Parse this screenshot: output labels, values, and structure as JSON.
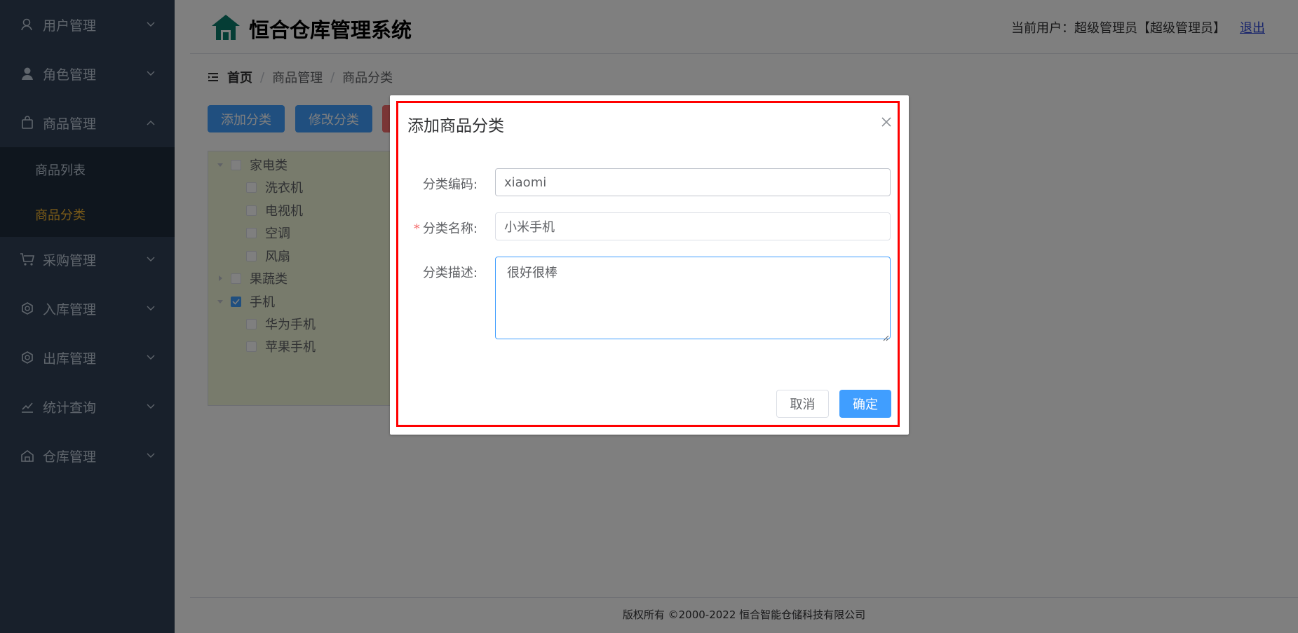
{
  "sidebar": {
    "items": [
      {
        "label": "用户管理",
        "icon": "user-outline-icon",
        "expanded": false
      },
      {
        "label": "角色管理",
        "icon": "user-solid-icon",
        "expanded": false
      },
      {
        "label": "商品管理",
        "icon": "shopping-bag-icon",
        "expanded": true,
        "children": [
          {
            "label": "商品列表",
            "active": false
          },
          {
            "label": "商品分类",
            "active": true
          }
        ]
      },
      {
        "label": "采购管理",
        "icon": "shopping-cart-icon",
        "expanded": false
      },
      {
        "label": "入库管理",
        "icon": "inbound-icon",
        "expanded": false
      },
      {
        "label": "出库管理",
        "icon": "outbound-icon",
        "expanded": false
      },
      {
        "label": "统计查询",
        "icon": "data-analysis-icon",
        "expanded": false
      },
      {
        "label": "仓库管理",
        "icon": "warehouse-icon",
        "expanded": false
      }
    ]
  },
  "header": {
    "title": "恒合仓库管理系统",
    "user_text": "当前用户：超级管理员【超级管理员】",
    "logout": "退出"
  },
  "breadcrumb": [
    "首页",
    "商品管理",
    "商品分类"
  ],
  "toolbar": {
    "add_label": "添加分类",
    "edit_label": "修改分类"
  },
  "tree": {
    "nodes": [
      {
        "label": "家电类",
        "level": 0,
        "expanded": true,
        "checked": false
      },
      {
        "label": "洗衣机",
        "level": 1,
        "checked": false
      },
      {
        "label": "电视机",
        "level": 1,
        "checked": false
      },
      {
        "label": "空调",
        "level": 1,
        "checked": false
      },
      {
        "label": "风扇",
        "level": 1,
        "checked": false
      },
      {
        "label": "果蔬类",
        "level": 0,
        "expanded": false,
        "checked": false
      },
      {
        "label": "手机",
        "level": 0,
        "expanded": true,
        "checked": true
      },
      {
        "label": "华为手机",
        "level": 1,
        "checked": false
      },
      {
        "label": "苹果手机",
        "level": 1,
        "checked": false
      }
    ]
  },
  "footer": {
    "text": "版权所有 ©2000-2022  恒合智能仓储科技有限公司"
  },
  "dialog": {
    "title": "添加商品分类",
    "code_label": "分类编码:",
    "code_value": "xiaomi",
    "name_label": "分类名称:",
    "name_value": "小米手机",
    "desc_label": "分类描述:",
    "desc_value": "很好很棒",
    "cancel": "取消",
    "ok": "确定"
  },
  "colors": {
    "sidebar_bg": "#304156",
    "sidebar_active": "#f7b731",
    "primary": "#409eff",
    "danger": "#f56c6c",
    "highlight": "#ff0000"
  }
}
